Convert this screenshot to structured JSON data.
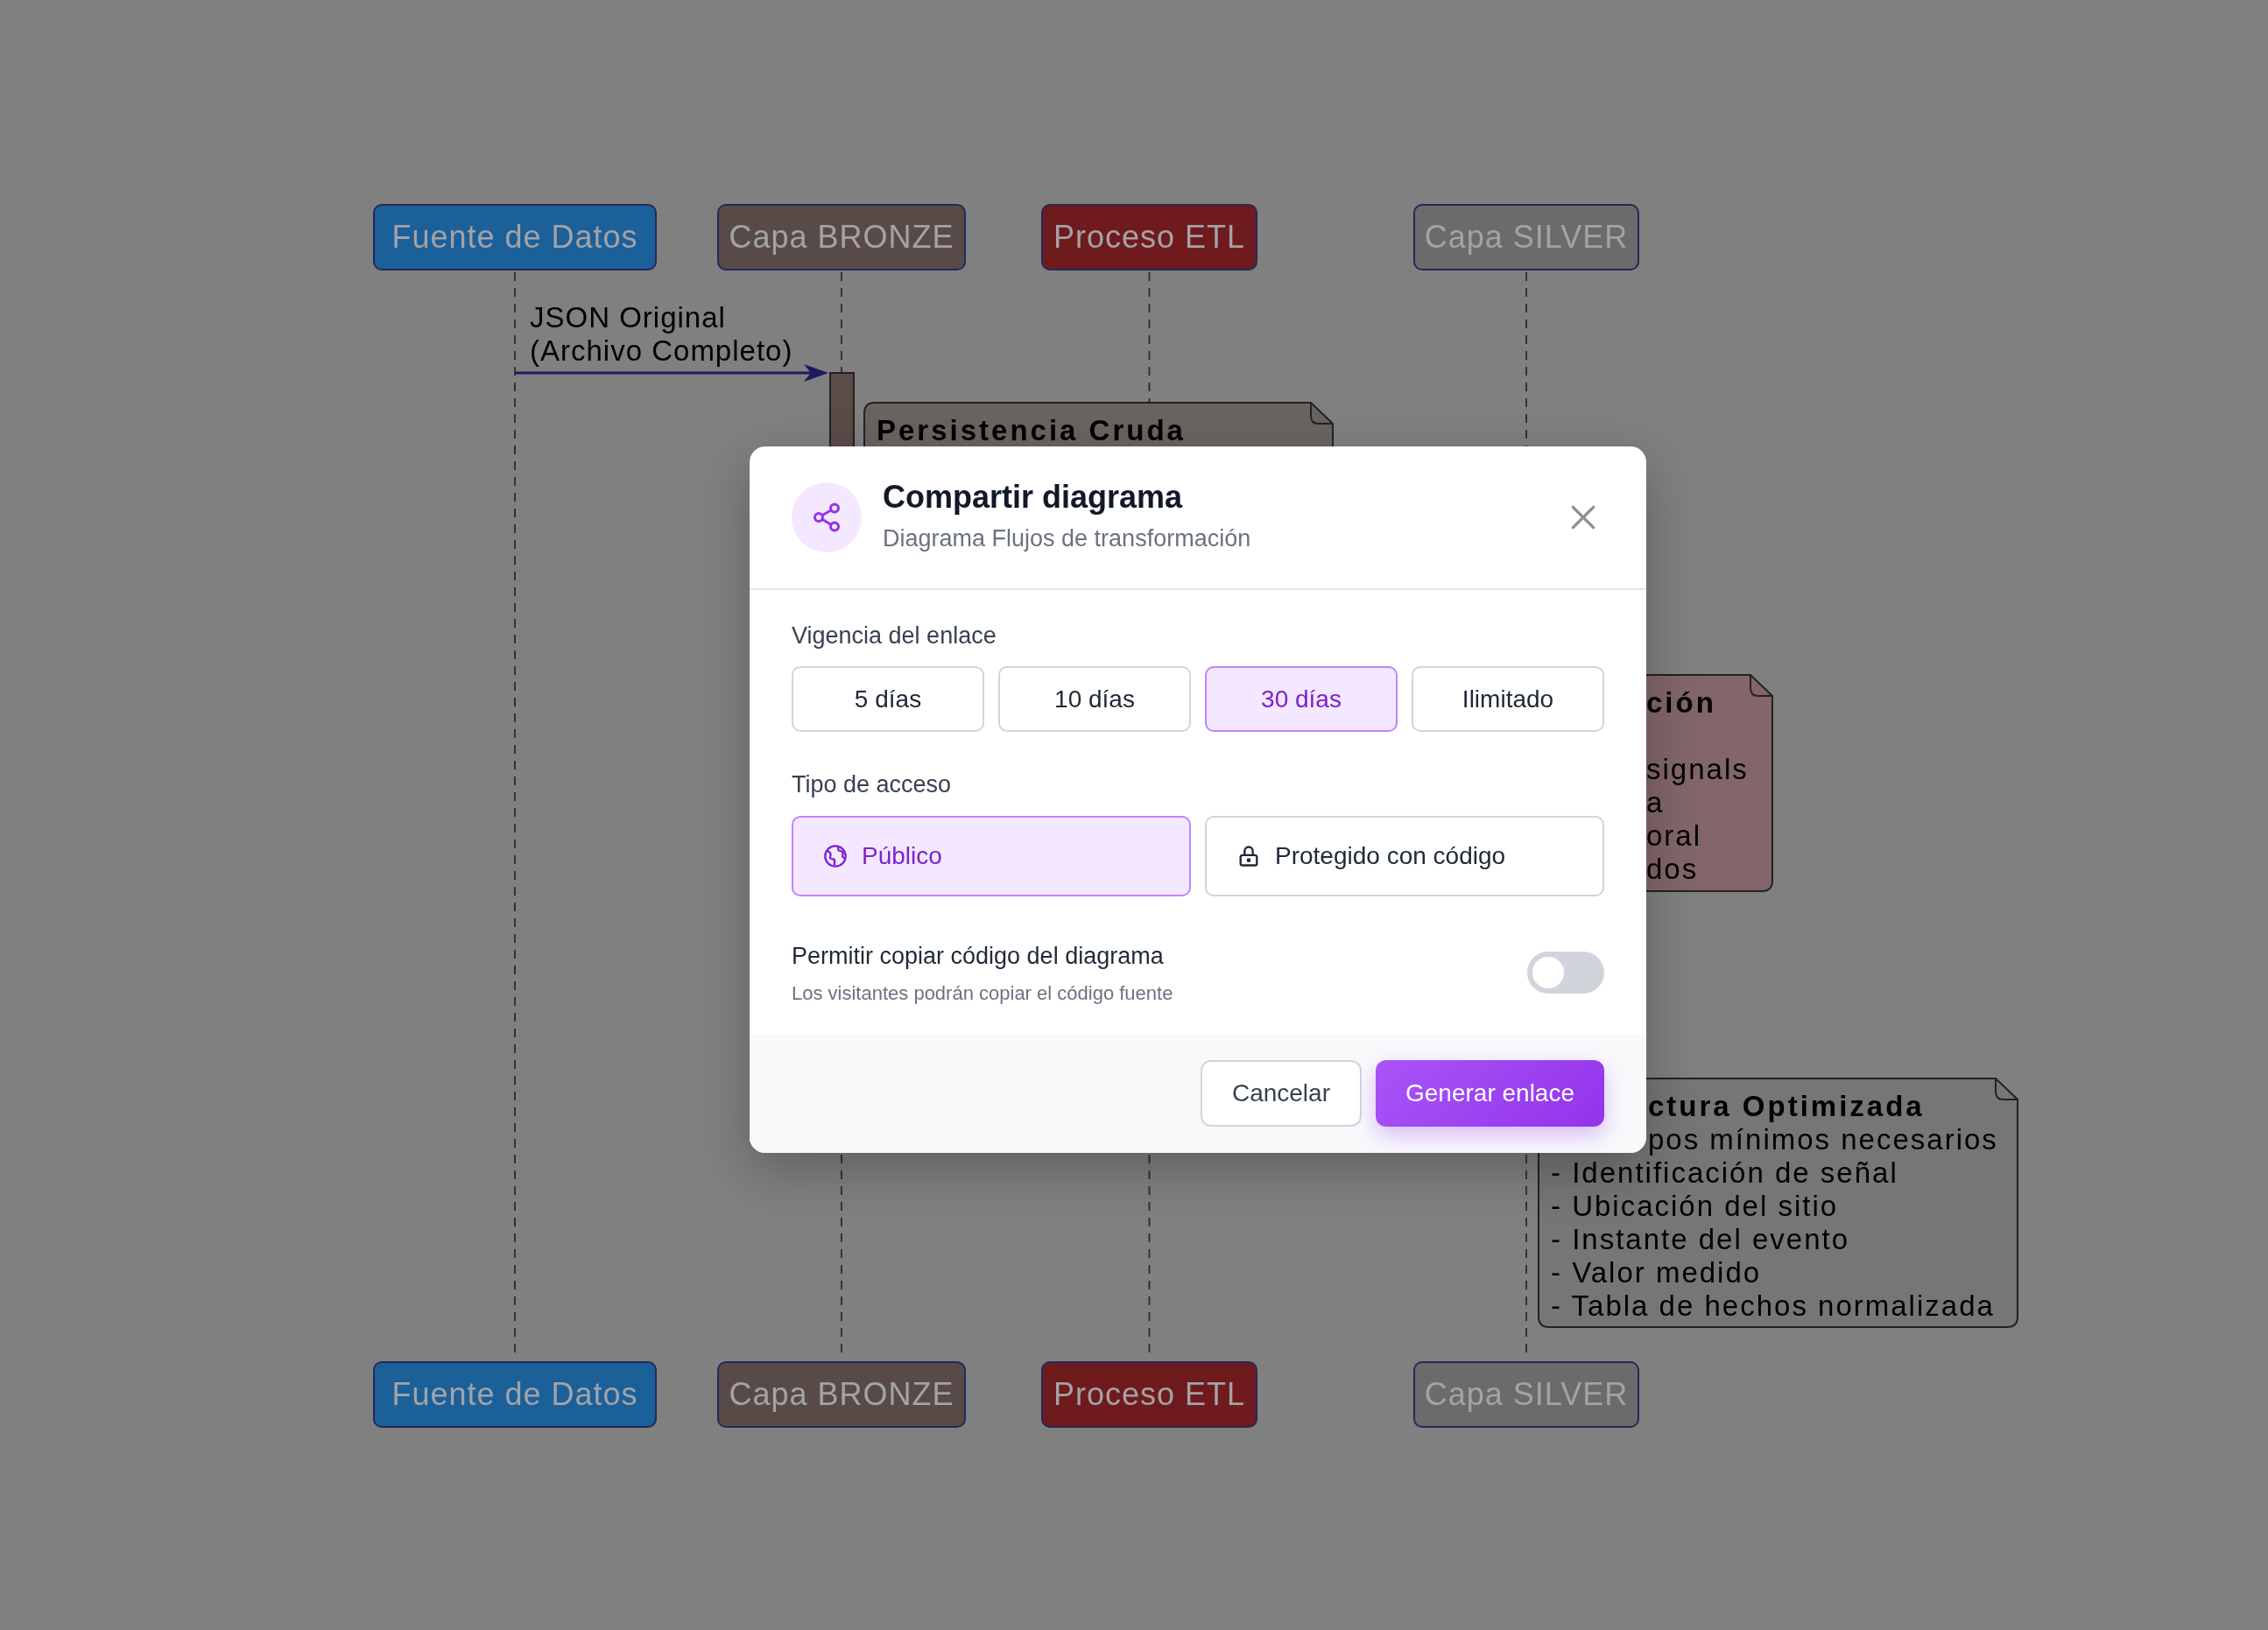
{
  "diagram": {
    "participants_top": [
      {
        "label": "Fuente de Datos",
        "color": "#1c609a"
      },
      {
        "label": "Capa BRONZE",
        "color": "#584b47"
      },
      {
        "label": "Proceso ETL",
        "color": "#6f1b1d"
      },
      {
        "label": "Capa SILVER",
        "color": "#6b6b6d"
      }
    ],
    "message": {
      "lines": [
        "JSON Original",
        "(Archivo Completo)"
      ]
    },
    "notes": [
      {
        "title": "Persistencia Cruda",
        "color": "#6a6461",
        "gap_after_title": false
      },
      {
        "title": "ción",
        "lines": [
          "signals",
          "a",
          "oral",
          "dos"
        ],
        "color": "#82666a",
        "gap_after_title": true
      },
      {
        "title": "ctura Optimizada",
        "lines": [
          "pos mínimos necesarios",
          "- Identificación de señal",
          "- Ubicación del sitio",
          "- Instante del evento",
          "- Valor medido",
          "- Tabla de hechos normalizada"
        ],
        "color": "#767676",
        "gap_after_title": false
      }
    ],
    "participants_bottom": [
      {
        "label": "Fuente de Datos",
        "color": "#1c609a"
      },
      {
        "label": "Capa BRONZE",
        "color": "#584b47"
      },
      {
        "label": "Proceso ETL",
        "color": "#6f1b1d"
      },
      {
        "label": "Capa SILVER",
        "color": "#6b6b6d"
      }
    ]
  },
  "dialog": {
    "title": "Compartir diagrama",
    "subtitle": "Diagrama Flujos de transformación",
    "duration": {
      "label": "Vigencia del enlace",
      "options": [
        {
          "label": "5 días",
          "selected": false
        },
        {
          "label": "10 días",
          "selected": false
        },
        {
          "label": "30 días",
          "selected": true
        },
        {
          "label": "Ilimitado",
          "selected": false
        }
      ]
    },
    "access": {
      "label": "Tipo de acceso",
      "options": [
        {
          "label": "Público",
          "kind": "globe",
          "selected": true
        },
        {
          "label": "Protegido con código",
          "kind": "lock",
          "selected": false
        }
      ]
    },
    "copy_code": {
      "label": "Permitir copiar código del diagrama",
      "description": "Los visitantes podrán copiar el código fuente",
      "on": false
    },
    "buttons": [
      {
        "label": "Cancelar",
        "kind": "secondary"
      },
      {
        "label": "Generar enlace",
        "kind": "primary"
      }
    ]
  }
}
